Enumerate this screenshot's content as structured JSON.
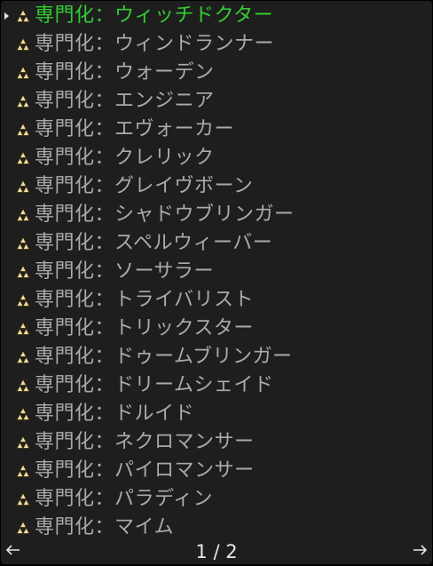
{
  "specializations": {
    "selected_index": 0,
    "items": [
      {
        "label": "専門化：ウィッチドクター"
      },
      {
        "label": "専門化：ウィンドランナー"
      },
      {
        "label": "専門化：ウォーデン"
      },
      {
        "label": "専門化：エンジニア"
      },
      {
        "label": "専門化：エヴォーカー"
      },
      {
        "label": "専門化：クレリック"
      },
      {
        "label": "専門化：グレイヴボーン"
      },
      {
        "label": "専門化：シャドウブリンガー"
      },
      {
        "label": "専門化：スペルウィーバー"
      },
      {
        "label": "専門化：ソーサラー"
      },
      {
        "label": "専門化：トライバリスト"
      },
      {
        "label": "専門化：トリックスター"
      },
      {
        "label": "専門化：ドゥームブリンガー"
      },
      {
        "label": "専門化：ドリームシェイド"
      },
      {
        "label": "専門化：ドルイド"
      },
      {
        "label": "専門化：ネクロマンサー"
      },
      {
        "label": "専門化：パイロマンサー"
      },
      {
        "label": "専門化：パラディン"
      },
      {
        "label": "専門化：マイム"
      }
    ]
  },
  "pager": {
    "current_page": 1,
    "total_pages": 2,
    "label": "1 / 2",
    "prev_icon": "arrow-left-icon",
    "next_icon": "arrow-right-icon"
  },
  "colors": {
    "background": "#1e1e1e",
    "item_text": "#aaaaaa",
    "selected_text": "#33cc33",
    "icon_gold": "#f0e0a0",
    "icon_outline": "#3a2a10"
  }
}
